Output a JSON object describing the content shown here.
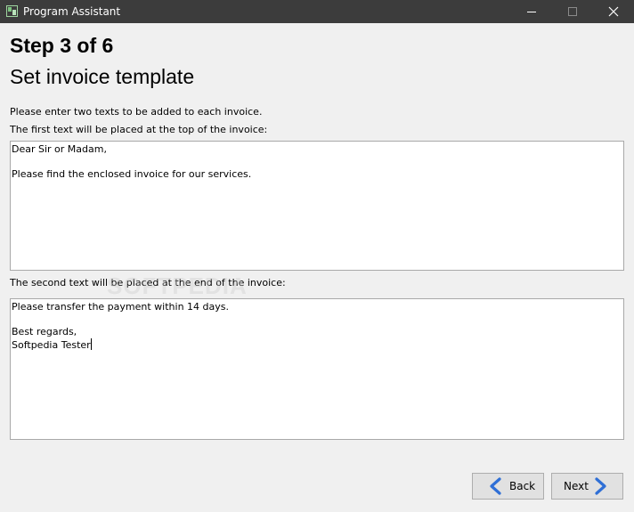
{
  "window": {
    "title": "Program Assistant",
    "icon": "app-icon",
    "controls": [
      "minimize-icon",
      "maximize-icon",
      "close-icon"
    ]
  },
  "header": {
    "step": "Step 3 of 6",
    "subtitle": "Set invoice template"
  },
  "form": {
    "intro": "Please enter two texts to be added to each invoice.",
    "first_label": "The first text will be placed at the top of the invoice:",
    "first_text": "Dear Sir or Madam,\n\nPlease find the enclosed invoice for our services.",
    "second_label": "The second text will be placed at the end of the invoice:",
    "second_text": "Please transfer the payment within 14 days.\n\nBest regards,\nSoftpedia Tester"
  },
  "buttons": {
    "back": "Back",
    "next": "Next"
  },
  "watermark": "SOFTPEDIA",
  "colors": {
    "titlebar": "#3c3c3c",
    "background": "#f0f0f0",
    "arrow": "#2f6fd6"
  }
}
